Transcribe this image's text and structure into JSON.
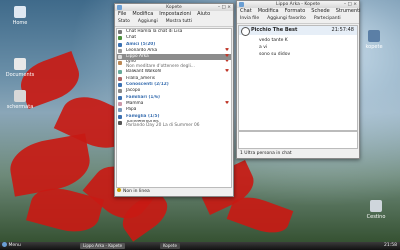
{
  "colors": {
    "accent": "#3a6fb0",
    "leaf": "#c81a14",
    "selected": "#8c8c8c"
  },
  "desktop_icons": [
    {
      "label": "Home",
      "icon": "home-folder-icon"
    },
    {
      "label": "Documents",
      "icon": "folder-icon"
    },
    {
      "label": "schermata",
      "icon": "image-file-icon"
    },
    {
      "label": "kopete",
      "icon": "network-icon"
    },
    {
      "label": "Cestino",
      "icon": "trash-icon"
    }
  ],
  "contact_window": {
    "title": "Kopete",
    "menu": [
      "File",
      "Modifica",
      "Impostazioni",
      "Aiuto"
    ],
    "toolbar": [
      "Stato",
      "Aggiungi",
      "Mostra tutti"
    ],
    "rows": [
      {
        "text": "Chat Hamla la chat di Lisa",
        "type": "contact"
      },
      {
        "text": "Chat",
        "type": "contact"
      },
      {
        "text": "Amici (5/20)",
        "type": "group"
      },
      {
        "text": "Leonardo Arka",
        "type": "contact"
      },
      {
        "text": "Lippo Arka",
        "type": "selected"
      },
      {
        "text": "Lyno",
        "sub": "Non meditare d'ottenere degli...",
        "type": "two"
      },
      {
        "text": "Balwant Walkohl",
        "type": "contact"
      },
      {
        "text": "Filalla_ameris",
        "type": "contact"
      },
      {
        "text": "Conoscenti (2/12)",
        "type": "group"
      },
      {
        "text": "Jacopo",
        "type": "contact"
      },
      {
        "text": "Familiari (1/6)",
        "type": "group"
      },
      {
        "text": "Mamma",
        "type": "contact"
      },
      {
        "text": "Papà",
        "type": "contact"
      },
      {
        "text": "Famiglia (1/5)",
        "type": "group"
      },
      {
        "text": "TurneMemories",
        "sub": "Parlando Day 20  La di Summer 06",
        "type": "two"
      }
    ],
    "status": "Non in linea"
  },
  "chat_window": {
    "title": "Lippo Arka - Kopete",
    "menu": [
      "Chat",
      "Modifica",
      "Formato",
      "Schede",
      "Strumenti"
    ],
    "toolbar": [
      "Invia file",
      "Aggiungi favorito",
      "Partecipanti"
    ],
    "header_name": "Picchio The Best",
    "header_time": "21:57:48",
    "messages": [
      "vedo tante K",
      "a vi",
      "sono su didov"
    ],
    "status": "1 Ultra persona in chat"
  },
  "taskbar": {
    "start_label": "Menu",
    "tasks": [
      "Lippo Arka - Kopete",
      "Kopete"
    ],
    "clock": "21:58"
  }
}
